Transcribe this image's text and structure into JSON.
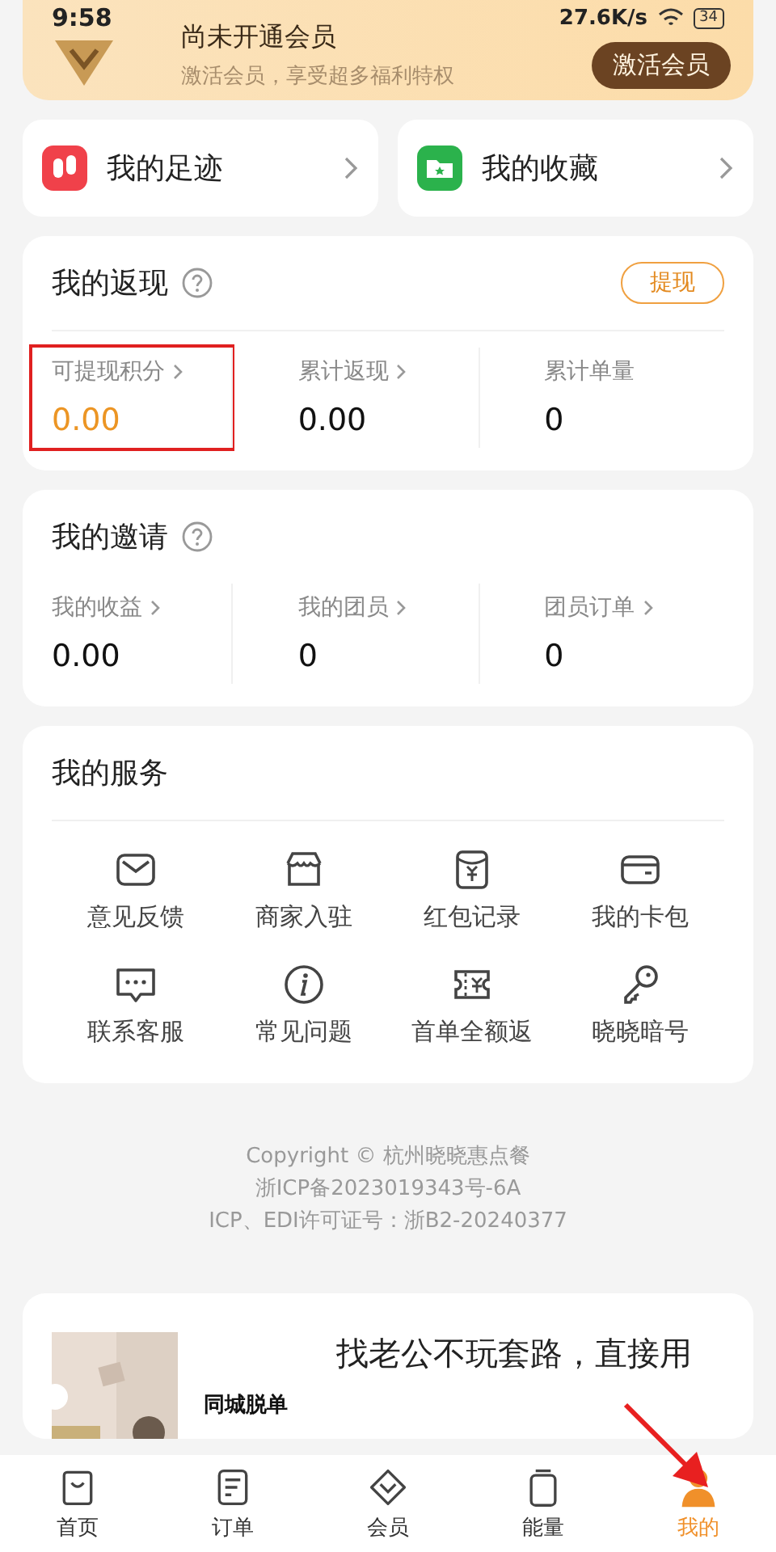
{
  "status_bar": {
    "time": "9:58",
    "speed": "27.6K/s",
    "battery": "34"
  },
  "member_banner": {
    "title": "尚未开通会员",
    "subtitle": "激活会员，享受超多福利特权",
    "button": "激活会员"
  },
  "quick_links": [
    {
      "label": "我的足迹",
      "kind": "footprint"
    },
    {
      "label": "我的收藏",
      "kind": "favorite"
    }
  ],
  "cashback": {
    "title": "我的返现",
    "button": "提现",
    "stats": [
      {
        "label": "可提现积分",
        "value": "0.00",
        "highlighted": true,
        "arrow": true
      },
      {
        "label": "累计返现",
        "value": "0.00",
        "highlighted": false,
        "arrow": true
      },
      {
        "label": "累计单量",
        "value": "0",
        "highlighted": false,
        "arrow": false
      }
    ]
  },
  "invite": {
    "title": "我的邀请",
    "stats": [
      {
        "label": "我的收益",
        "value": "0.00"
      },
      {
        "label": "我的团员",
        "value": "0"
      },
      {
        "label": "团员订单",
        "value": "0"
      }
    ]
  },
  "services": {
    "title": "我的服务",
    "items": [
      {
        "label": "意见反馈",
        "kind": "mail"
      },
      {
        "label": "商家入驻",
        "kind": "shop"
      },
      {
        "label": "红包记录",
        "kind": "redpacket"
      },
      {
        "label": "我的卡包",
        "kind": "card"
      },
      {
        "label": "联系客服",
        "kind": "chat"
      },
      {
        "label": "常见问题",
        "kind": "info"
      },
      {
        "label": "首单全额返",
        "kind": "ticket"
      },
      {
        "label": "晓晓暗号",
        "kind": "key"
      }
    ]
  },
  "copyright": [
    "Copyright © 杭州晓晓惠点餐",
    "浙ICP备2023019343号-6A",
    "ICP、EDI许可证号：浙B2-20240377"
  ],
  "ad": {
    "kind": "picture",
    "tag": "同城脱单",
    "text": "找老公不玩套路，直接用"
  },
  "tab_bar": [
    {
      "label": "首页",
      "kind": "bag",
      "selected": false
    },
    {
      "label": "订单",
      "kind": "list",
      "selected": false
    },
    {
      "label": "会员",
      "kind": "diamond",
      "selected": false
    },
    {
      "label": "能量",
      "kind": "cup",
      "selected": false
    },
    {
      "label": "我的",
      "kind": "person",
      "selected": true
    }
  ]
}
